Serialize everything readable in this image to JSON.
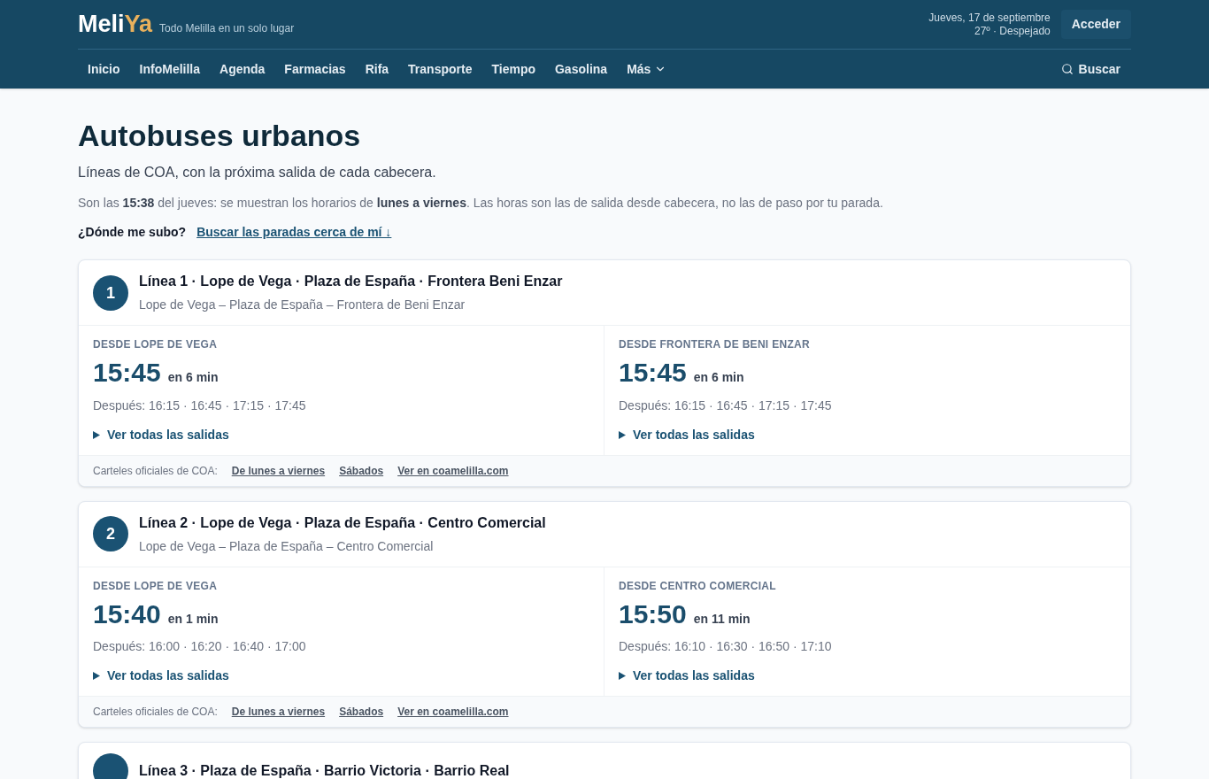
{
  "header": {
    "logo_main": "Meli",
    "logo_accent": "Ya",
    "tagline": "Todo Melilla en un solo lugar",
    "date": "Jueves, 17 de septiembre",
    "weather": "27º · Despejado",
    "login": "Acceder"
  },
  "nav": {
    "items": [
      {
        "label": "Inicio",
        "dropdown": false
      },
      {
        "label": "InfoMelilla",
        "dropdown": false
      },
      {
        "label": "Agenda",
        "dropdown": false
      },
      {
        "label": "Farmacias",
        "dropdown": false
      },
      {
        "label": "Rifa",
        "dropdown": false
      },
      {
        "label": "Transporte",
        "dropdown": false
      },
      {
        "label": "Tiempo",
        "dropdown": false
      },
      {
        "label": "Gasolina",
        "dropdown": false
      },
      {
        "label": "Más",
        "dropdown": true
      }
    ],
    "search": "Buscar"
  },
  "page": {
    "title": "Autobuses urbanos",
    "subtitle": "Líneas de COA, con la próxima salida de cada cabecera.",
    "note": "Son las **15:38** del jueves: se muestran los horarios de **lunes a viernes**. Las horas son las de salida desde cabecera, no las de paso por tu parada.",
    "where_label": "¿Dónde me subo?",
    "where_link": "Buscar las paradas cerca de mí ↓"
  },
  "lines": [
    {
      "number": "1",
      "title": "Línea 1 · Lope de Vega · Plaza de España · Frontera Beni Enzar",
      "route": "Lope de Vega – Plaza de España – Frontera de Beni Enzar",
      "directions": [
        {
          "from": "DESDE LOPE DE VEGA",
          "time": "15:45",
          "eta": "en 6 min",
          "after": "Después: 16:15 · 16:45 · 17:15 · 17:45",
          "more": "Ver todas las salidas"
        },
        {
          "from": "DESDE FRONTERA DE BENI ENZAR",
          "time": "15:45",
          "eta": "en 6 min",
          "after": "Después: 16:15 · 16:45 · 17:15 · 17:45",
          "more": "Ver todas las salidas"
        }
      ],
      "footer_label": "Carteles oficiales de COA:",
      "footer_links": [
        "De lunes a viernes",
        "Sábados",
        "Ver en coamelilla.com"
      ]
    },
    {
      "number": "2",
      "title": "Línea 2 · Lope de Vega · Plaza de España · Centro Comercial",
      "route": "Lope de Vega – Plaza de España – Centro Comercial",
      "directions": [
        {
          "from": "DESDE LOPE DE VEGA",
          "time": "15:40",
          "eta": "en 1 min",
          "after": "Después: 16:00 · 16:20 · 16:40 · 17:00",
          "more": "Ver todas las salidas"
        },
        {
          "from": "DESDE CENTRO COMERCIAL",
          "time": "15:50",
          "eta": "en 11 min",
          "after": "Después: 16:10 · 16:30 · 16:50 · 17:10",
          "more": "Ver todas las salidas"
        }
      ],
      "footer_label": "Carteles oficiales de COA:",
      "footer_links": [
        "De lunes a viernes",
        "Sábados",
        "Ver en coamelilla.com"
      ]
    },
    {
      "title": "Línea 3 · Plaza de España · Barrio Victoria · Barrio Real"
    }
  ]
}
